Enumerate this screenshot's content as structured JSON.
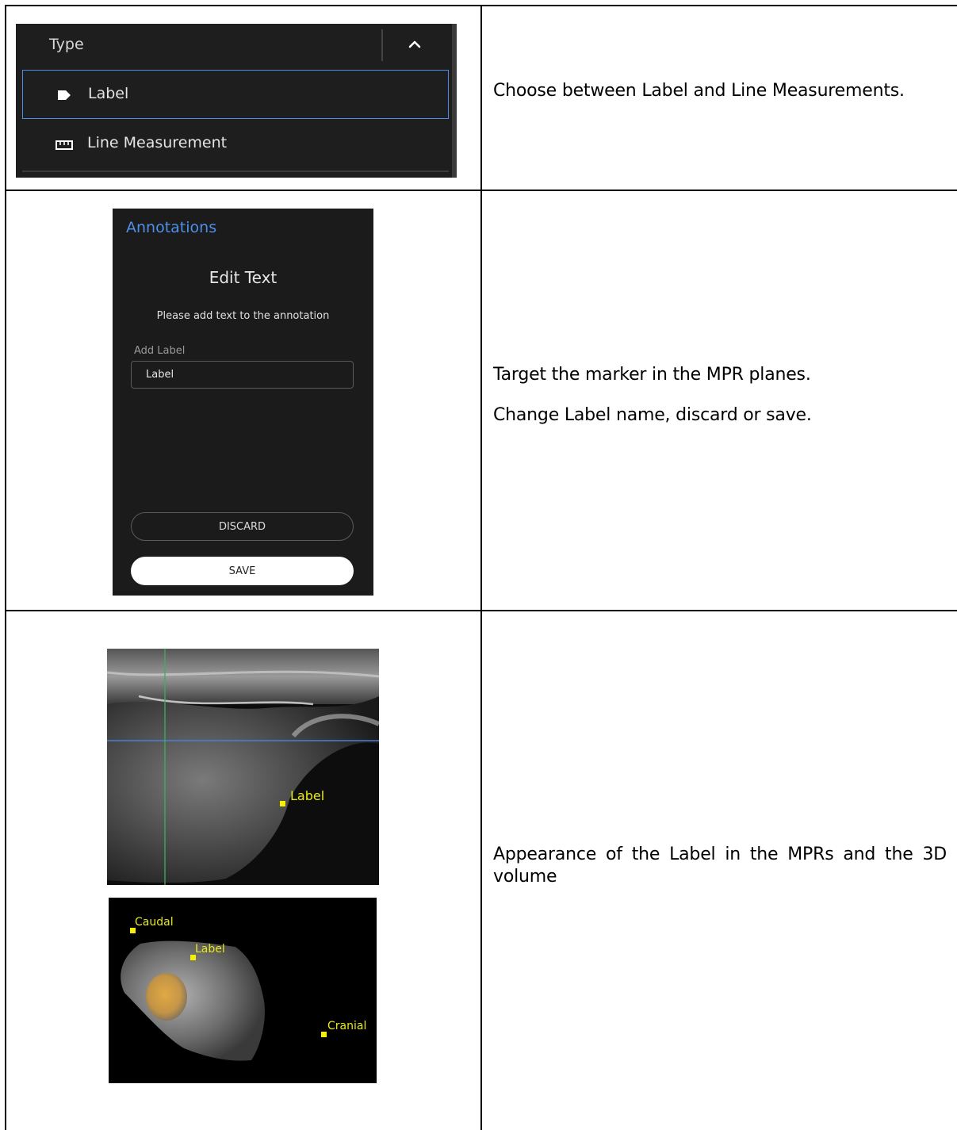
{
  "row1": {
    "type_panel": {
      "title": "Type",
      "options": [
        {
          "label": "Label",
          "icon": "tag-icon",
          "selected": true
        },
        {
          "label": "Line Measurement",
          "icon": "ruler-icon",
          "selected": false
        }
      ]
    },
    "description": [
      "Choose between Label and Line Measurements."
    ]
  },
  "row2": {
    "annotations_panel": {
      "title": "Annotations",
      "heading": "Edit Text",
      "message": "Please add text to the annotation",
      "field_label": "Add Label",
      "field_value": "Label",
      "discard_label": "DISCARD",
      "save_label": "SAVE"
    },
    "description": [
      "Target the marker in the MPR planes.",
      "Change Label name, discard or save."
    ]
  },
  "row3": {
    "mpr_image": {
      "marker_label": "Label"
    },
    "volume_image": {
      "labels": [
        "Caudal",
        "Label",
        "Cranial"
      ]
    },
    "description": [
      "Appearance of the Label in the MPRs and the 3D volume"
    ]
  },
  "colors": {
    "accent_blue": "#4a8fe2",
    "marker_yellow": "#f5f000",
    "panel_bg": "#1e1e1e"
  }
}
